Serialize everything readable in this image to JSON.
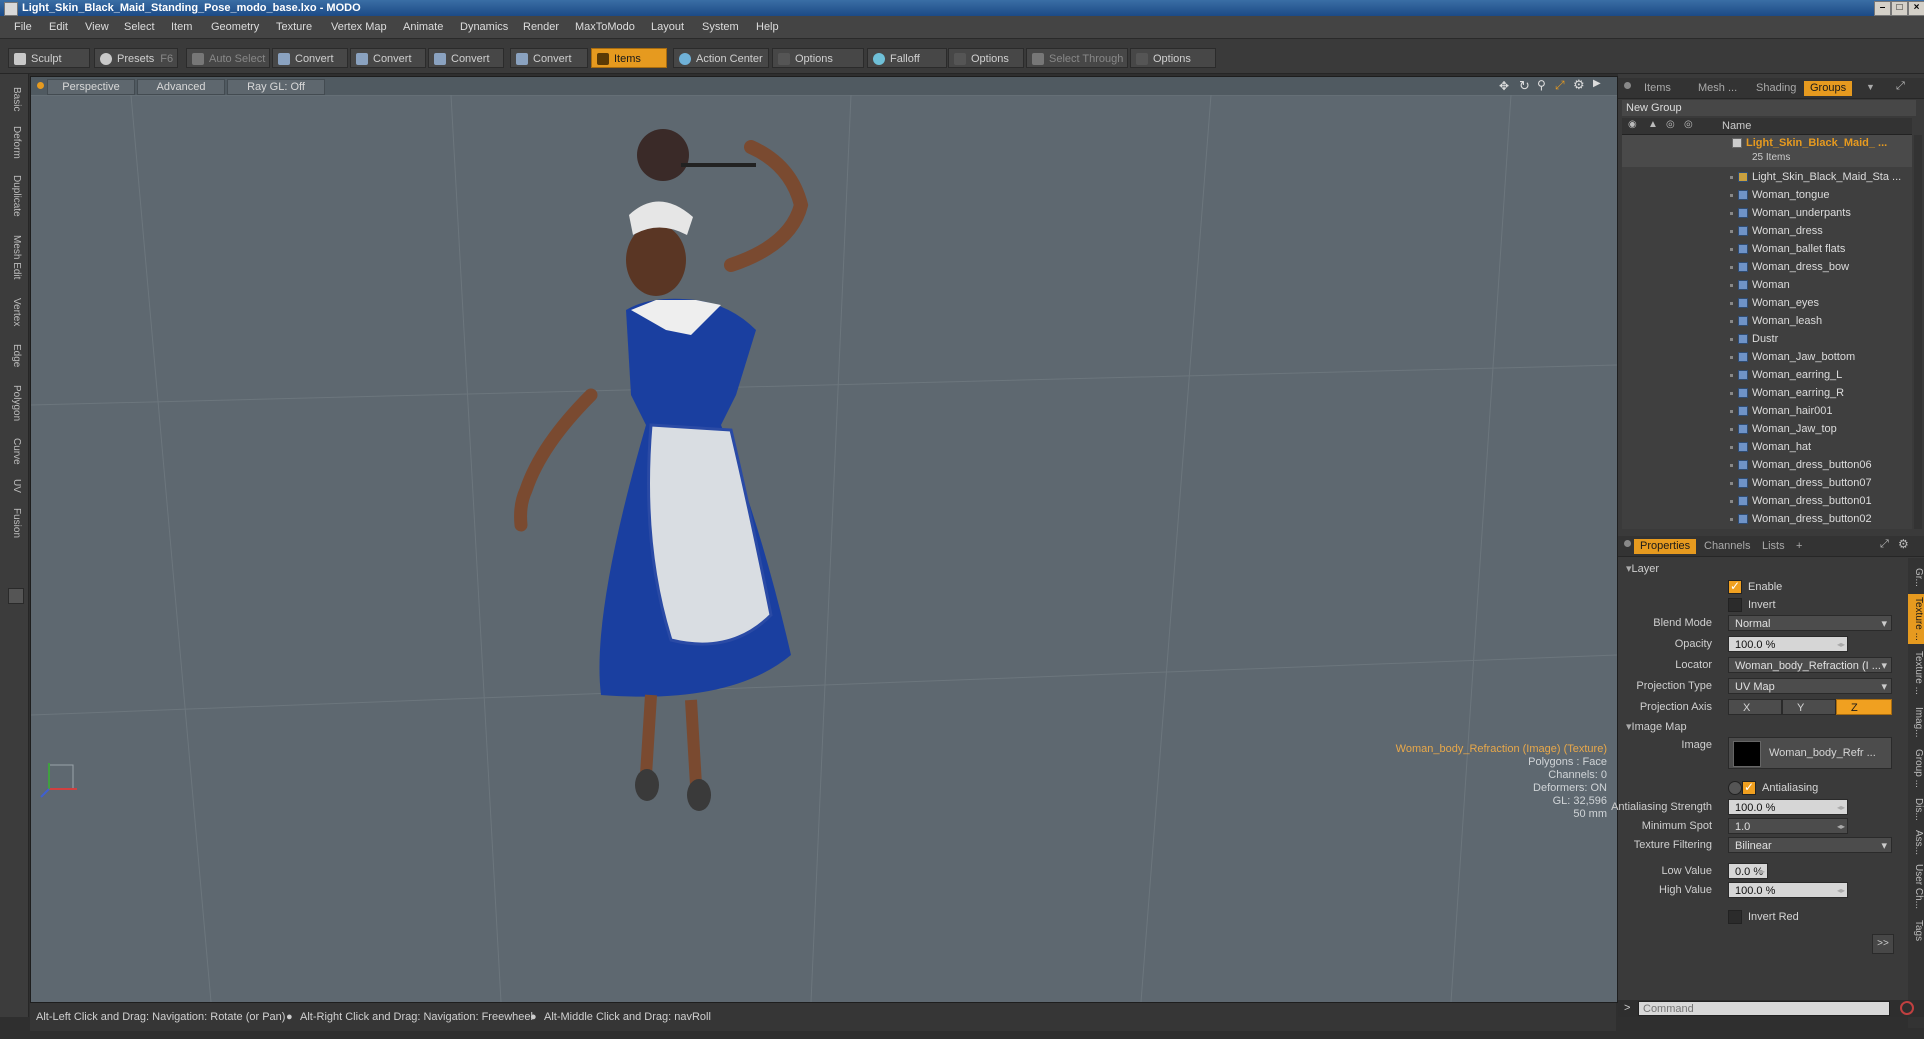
{
  "window": {
    "title": "Light_Skin_Black_Maid_Standing_Pose_modo_base.lxo - MODO"
  },
  "menu": [
    "File",
    "Edit",
    "View",
    "Select",
    "Item",
    "Geometry",
    "Texture",
    "Vertex Map",
    "Animate",
    "Dynamics",
    "Render",
    "MaxToModo",
    "Layout",
    "System",
    "Help"
  ],
  "toolbar": {
    "sculpt": "Sculpt",
    "presets": "Presets",
    "presets_key": "F6",
    "auto_select": "Auto Select",
    "convert1": "Convert",
    "convert2": "Convert",
    "convert3": "Convert",
    "convert4": "Convert",
    "items": "Items",
    "action_center": "Action Center",
    "options1": "Options",
    "falloff": "Falloff",
    "options2": "Options",
    "select_through": "Select Through",
    "options3": "Options"
  },
  "left_tabs": [
    "Basic",
    "Deform",
    "Duplicate",
    "Mesh Edit",
    "Vertex",
    "Edge",
    "Polygon",
    "Curve",
    "UV",
    "Fusion"
  ],
  "viewport": {
    "view_mode": "Perspective",
    "advanced": "Advanced",
    "raygl": "Ray GL: Off",
    "info": {
      "selection": "Woman_body_Refraction (Image) (Texture)",
      "polygons": "Polygons : Face",
      "channels": "Channels: 0",
      "deformers": "Deformers: ON",
      "gl": "GL: 32,596",
      "scale": "50 mm"
    }
  },
  "status": {
    "hint1": "Alt-Left Click and Drag: Navigation: Rotate (or Pan)",
    "hint2": "Alt-Right Click and Drag: Navigation: Freewheel",
    "hint3": "Alt-Middle Click and Drag: navRoll"
  },
  "groups_panel": {
    "tabs": [
      "Items",
      "Mesh ...",
      "Shading",
      "Groups"
    ],
    "active_tab": "Groups",
    "new_group": "New Group",
    "name_header": "Name",
    "group_name": "Light_Skin_Black_Maid_ ...",
    "group_count": "25 Items",
    "items": [
      "Light_Skin_Black_Maid_Sta ...",
      "Woman_tongue",
      "Woman_underpants",
      "Woman_dress",
      "Woman_ballet flats",
      "Woman_dress_bow",
      "Woman",
      "Woman_eyes",
      "Woman_leash",
      "Dustr",
      "Woman_Jaw_bottom",
      "Woman_earring_L",
      "Woman_earring_R",
      "Woman_hair001",
      "Woman_Jaw_top",
      "Woman_hat",
      "Woman_dress_button06",
      "Woman_dress_button07",
      "Woman_dress_button01",
      "Woman_dress_button02"
    ]
  },
  "properties_panel": {
    "tabs": [
      "Properties",
      "Channels",
      "Lists",
      "+"
    ],
    "section_layer": "Layer",
    "enable": "Enable",
    "invert": "Invert",
    "blend_mode_label": "Blend Mode",
    "blend_mode": "Normal",
    "opacity_label": "Opacity",
    "opacity": "100.0 %",
    "locator_label": "Locator",
    "locator": "Woman_body_Refraction (I ...",
    "projection_type_label": "Projection Type",
    "projection_type": "UV Map",
    "projection_axis_label": "Projection Axis",
    "axis_x": "X",
    "axis_y": "Y",
    "axis_z": "Z",
    "section_image_map": "Image Map",
    "image_label": "Image",
    "image": "Woman_body_Refr ...",
    "antialiasing": "Antialiasing",
    "aa_strength_label": "Antialiasing Strength",
    "aa_strength": "100.0 %",
    "min_spot_label": "Minimum Spot",
    "min_spot": "1.0",
    "tex_filter_label": "Texture Filtering",
    "tex_filter": "Bilinear",
    "low_value_label": "Low Value",
    "low_value": "0.0 %",
    "high_value_label": "High Value",
    "high_value": "100.0 %",
    "invert_red": "Invert Red",
    "more": ">>",
    "side_tabs": [
      "Gr...",
      "Texture ...",
      "Texture ...",
      "Imag...",
      "Group ...",
      "Dis...",
      "Ass...",
      "User Ch...",
      "Tags"
    ]
  },
  "command": {
    "placeholder": "Command",
    "prompt": ">"
  },
  "colors": {
    "accent": "#e69a1f",
    "viewport": "#5e6870",
    "dress": "#1a3fa0"
  }
}
